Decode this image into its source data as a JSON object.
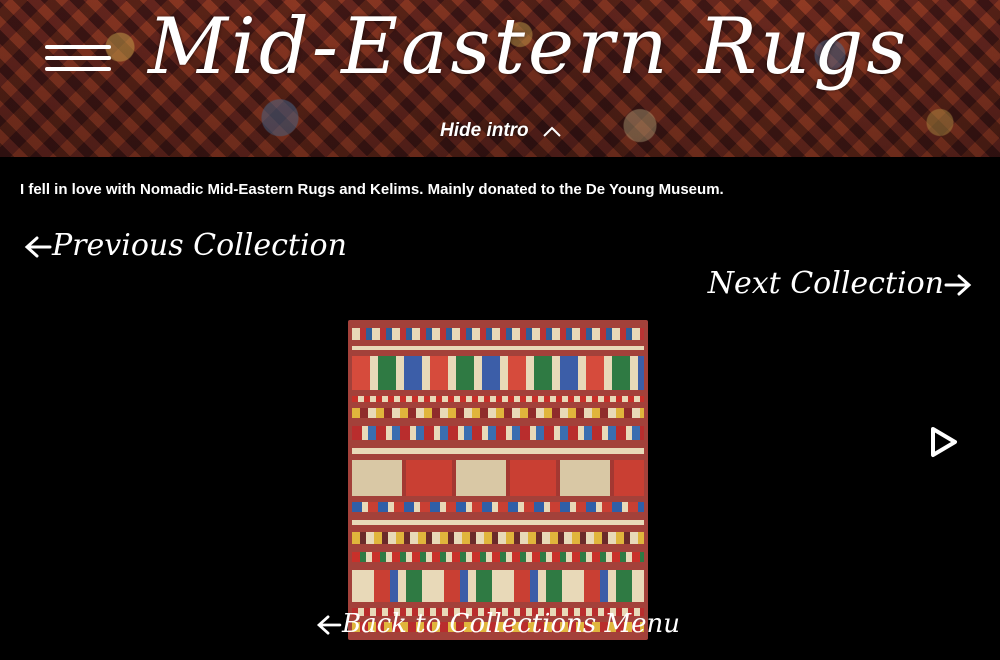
{
  "header": {
    "title": "Mid-Eastern Rugs",
    "hide_intro_label": "Hide intro"
  },
  "intro": {
    "text": "I fell in love with Nomadic Mid-Eastern Rugs and Kelims. Mainly donated to the De Young Museum."
  },
  "nav": {
    "previous_label": "Previous Collection",
    "next_label": "Next Collection",
    "back_label": "Back to Collections Menu"
  },
  "icons": {
    "menu": "hamburger-menu-icon",
    "hide_intro": "chevron-up-icon",
    "previous": "arrow-left-icon",
    "next": "arrow-right-icon",
    "back": "arrow-left-icon",
    "slideshow": "play-icon"
  },
  "colors": {
    "background": "#000000",
    "text": "#ffffff",
    "rug_red": "#a3413a"
  }
}
